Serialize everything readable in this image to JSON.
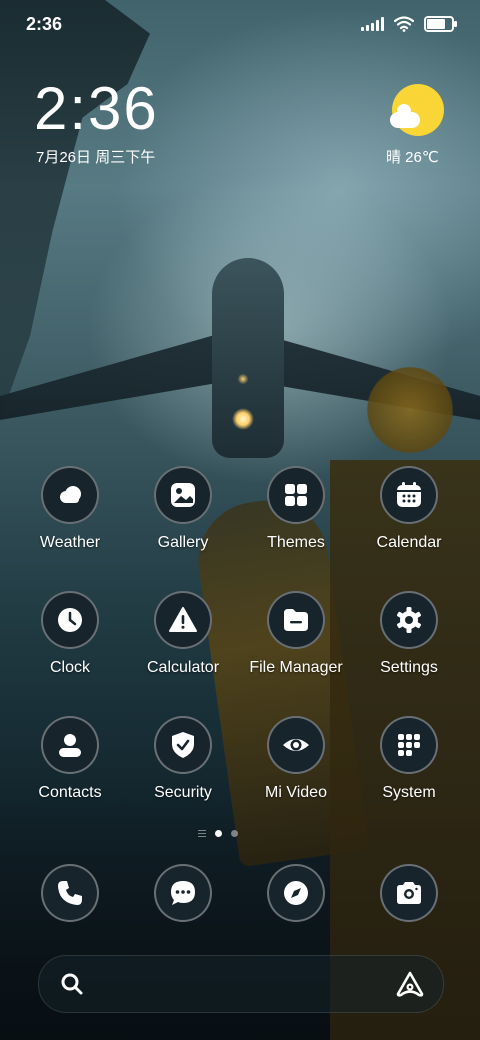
{
  "status_bar": {
    "time": "2:36",
    "battery_level": 0.9,
    "signal_bars": 5
  },
  "clock_widget": {
    "time": "2:36",
    "date": "7月26日 周三下午"
  },
  "weather_widget": {
    "text": "晴 26℃",
    "icon": "sun-cloud-icon"
  },
  "apps": [
    {
      "label": "Weather",
      "icon": "weather-cloud-icon"
    },
    {
      "label": "Gallery",
      "icon": "gallery-image-icon"
    },
    {
      "label": "Themes",
      "icon": "themes-grid-icon"
    },
    {
      "label": "Calendar",
      "icon": "calendar-icon"
    },
    {
      "label": "Clock",
      "icon": "clock-icon"
    },
    {
      "label": "Calculator",
      "icon": "warning-triangle-icon"
    },
    {
      "label": "File Manager",
      "icon": "folder-icon"
    },
    {
      "label": "Settings",
      "icon": "gear-icon"
    },
    {
      "label": "Contacts",
      "icon": "person-icon"
    },
    {
      "label": "Security",
      "icon": "shield-check-icon"
    },
    {
      "label": "Mi Video",
      "icon": "eye-icon"
    },
    {
      "label": "System",
      "icon": "folder-grid-icon"
    }
  ],
  "dock": [
    {
      "icon": "phone-icon"
    },
    {
      "icon": "message-icon"
    },
    {
      "icon": "compass-icon"
    },
    {
      "icon": "camera-icon"
    }
  ],
  "pager": {
    "pages": 2,
    "active": 1
  },
  "search": {
    "icon": "search-icon",
    "assistant_icon": "assistant-icon"
  },
  "colors": {
    "icon_bg": "#17242b",
    "sun": "#f9d535"
  }
}
